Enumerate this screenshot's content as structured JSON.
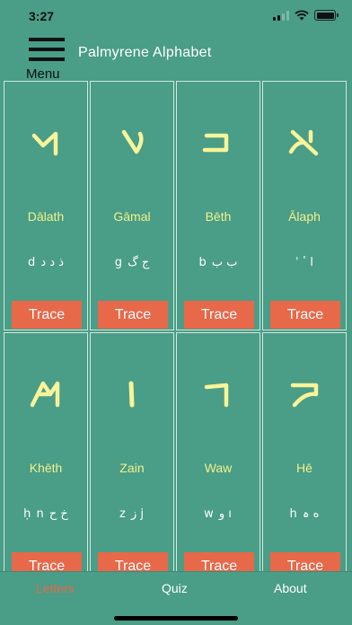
{
  "status": {
    "time": "3:27"
  },
  "header": {
    "menu_label": "Menu",
    "title": "Palmyrene Alphabet"
  },
  "cards": [
    {
      "name": "Dālath",
      "translit": "d ذ د ﺩ",
      "glyph_icon": "palmyrene-dalath-glyph",
      "trace_label": "Trace"
    },
    {
      "name": "Gāmal",
      "translit": "g ج گ",
      "glyph_icon": "palmyrene-gamal-glyph",
      "trace_label": "Trace"
    },
    {
      "name": "Bēth",
      "translit": "b ب ﺏ",
      "glyph_icon": "palmyrene-beth-glyph",
      "trace_label": "Trace"
    },
    {
      "name": "Ālaph",
      "translit": "ʾ ا ٴ",
      "glyph_icon": "palmyrene-alaph-glyph",
      "trace_label": "Trace"
    },
    {
      "name": "Khēth",
      "translit": "ḥ n خ ح",
      "glyph_icon": "palmyrene-kheth-glyph",
      "trace_label": "Trace"
    },
    {
      "name": "Zain",
      "translit": "z ز j",
      "glyph_icon": "palmyrene-zain-glyph",
      "trace_label": "Trace"
    },
    {
      "name": "Waw",
      "translit": "w و ı",
      "glyph_icon": "palmyrene-waw-glyph",
      "trace_label": "Trace"
    },
    {
      "name": "Hē",
      "translit": "h ه ہ",
      "glyph_icon": "palmyrene-he-glyph",
      "trace_label": "Trace"
    }
  ],
  "tabs": {
    "letters": "Letters",
    "quiz": "Quiz",
    "about": "About"
  },
  "colors": {
    "background": "#4a9d86",
    "accent": "#e8684a",
    "glyph": "#f7f49a",
    "name": "#f2f28c"
  }
}
